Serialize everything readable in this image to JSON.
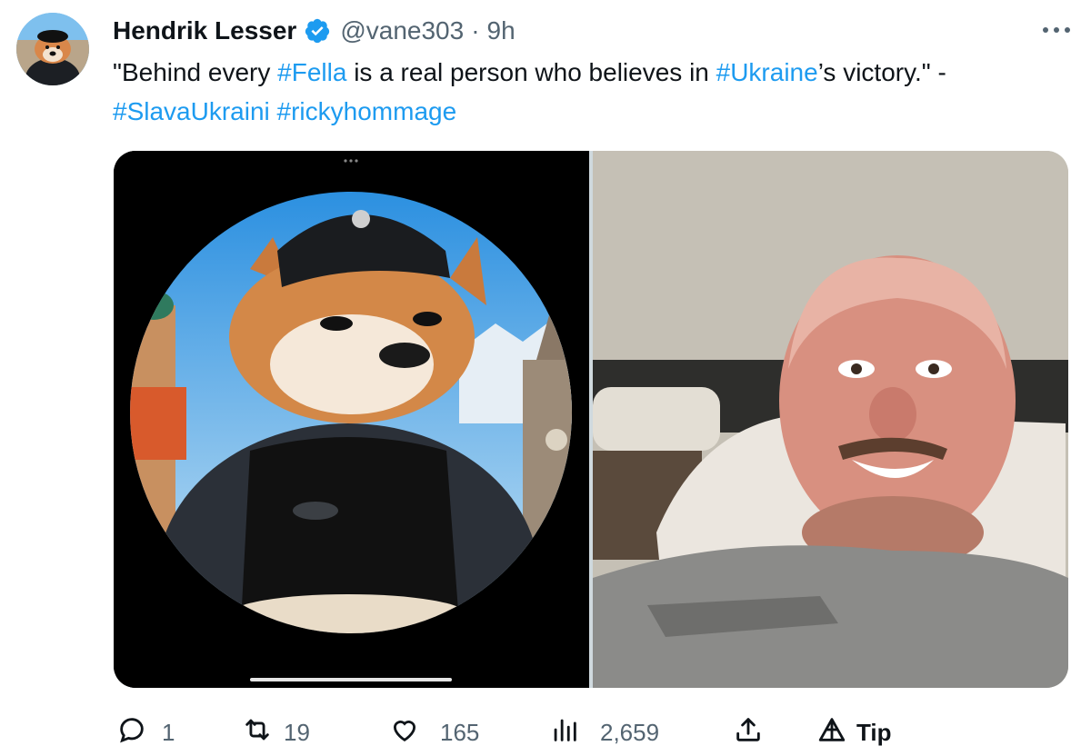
{
  "author": {
    "name": "Hendrik Lesser",
    "handle": "@vane303",
    "separator": "·",
    "time": "9h"
  },
  "tweet": {
    "text_parts": [
      {
        "text": "\"Behind every ",
        "hashtag": false
      },
      {
        "text": "#Fella",
        "hashtag": true
      },
      {
        "text": " is a real person who believes in ",
        "hashtag": false
      },
      {
        "text": "#Ukraine",
        "hashtag": true
      },
      {
        "text": "’s victory.\" - ",
        "hashtag": false
      },
      {
        "text": "#SlavaUkraini",
        "hashtag": true
      },
      {
        "text": " ",
        "hashtag": false
      },
      {
        "text": "#rickyhommage",
        "hashtag": true
      }
    ]
  },
  "actions": {
    "reply_count": "1",
    "retweet_count": "19",
    "like_count": "165",
    "views_count": "2,659",
    "tip_label": "Tip"
  },
  "colors": {
    "hashtag": "#1d9bf0",
    "muted": "#536471",
    "verified": "#1d9bf0"
  },
  "icons": [
    "verified-badge-icon",
    "more-options-icon",
    "reply-icon",
    "retweet-icon",
    "like-icon",
    "views-icon",
    "share-icon",
    "tip-icon"
  ]
}
